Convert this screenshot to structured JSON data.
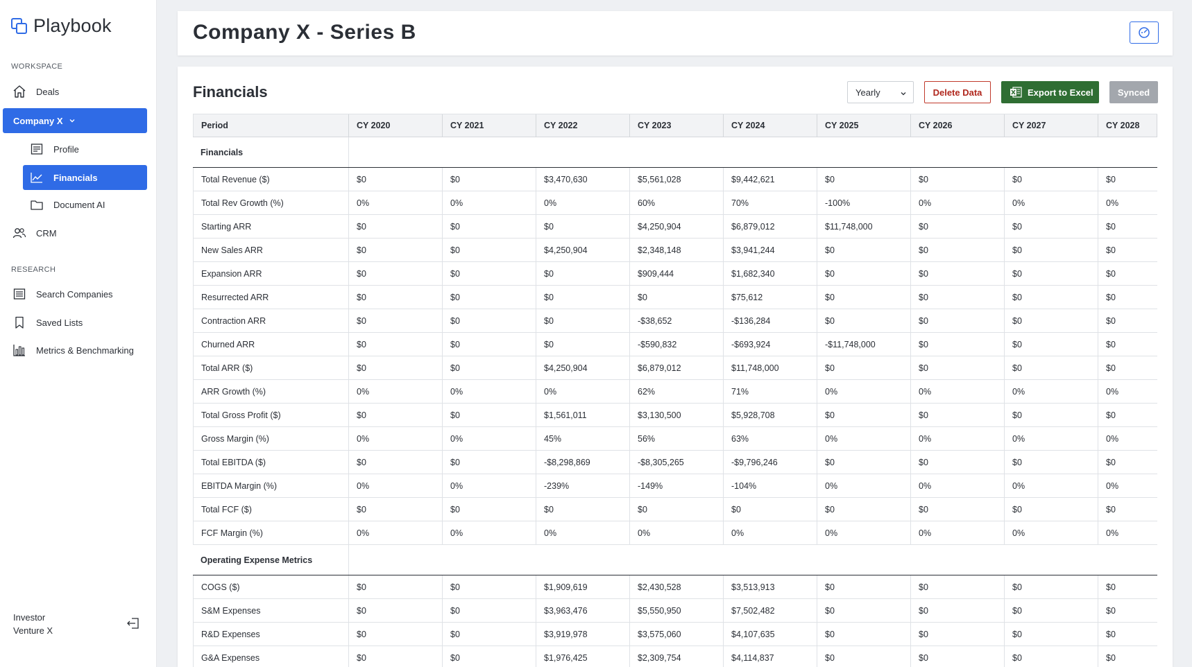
{
  "app": {
    "name": "Playbook",
    "brand_color": "#2f6be6"
  },
  "sidebar": {
    "workspace_label": "WORKSPACE",
    "deals": "Deals",
    "company": "Company X",
    "company_sub": [
      "Profile",
      "Financials",
      "Document AI"
    ],
    "crm": "CRM",
    "research_label": "RESEARCH",
    "research_items": [
      "Search Companies",
      "Saved Lists",
      "Metrics & Benchmarking"
    ],
    "user_role": "Investor",
    "user_org": "Venture X"
  },
  "header": {
    "title": "Company X - Series B"
  },
  "financials": {
    "title": "Financials",
    "period_select": "Yearly",
    "delete_label": "Delete Data",
    "export_label": "Export to Excel",
    "synced_label": "Synced",
    "columns": [
      "Period",
      "CY 2020",
      "CY 2021",
      "CY 2022",
      "CY 2023",
      "CY 2024",
      "CY 2025",
      "CY 2026",
      "CY 2027",
      "CY 2028"
    ],
    "groups": [
      {
        "name": "Financials",
        "rows": [
          {
            "label": "Total Revenue ($)",
            "values": [
              "$0",
              "$0",
              "$3,470,630",
              "$5,561,028",
              "$9,442,621",
              "$0",
              "$0",
              "$0",
              "$0"
            ]
          },
          {
            "label": "Total Rev Growth (%)",
            "values": [
              "0%",
              "0%",
              "0%",
              "60%",
              "70%",
              "-100%",
              "0%",
              "0%",
              "0%"
            ]
          },
          {
            "label": "Starting ARR",
            "values": [
              "$0",
              "$0",
              "$0",
              "$4,250,904",
              "$6,879,012",
              "$11,748,000",
              "$0",
              "$0",
              "$0"
            ]
          },
          {
            "label": "New Sales ARR",
            "values": [
              "$0",
              "$0",
              "$4,250,904",
              "$2,348,148",
              "$3,941,244",
              "$0",
              "$0",
              "$0",
              "$0"
            ]
          },
          {
            "label": "Expansion ARR",
            "values": [
              "$0",
              "$0",
              "$0",
              "$909,444",
              "$1,682,340",
              "$0",
              "$0",
              "$0",
              "$0"
            ]
          },
          {
            "label": "Resurrected ARR",
            "values": [
              "$0",
              "$0",
              "$0",
              "$0",
              "$75,612",
              "$0",
              "$0",
              "$0",
              "$0"
            ]
          },
          {
            "label": "Contraction ARR",
            "values": [
              "$0",
              "$0",
              "$0",
              "-$38,652",
              "-$136,284",
              "$0",
              "$0",
              "$0",
              "$0"
            ]
          },
          {
            "label": "Churned ARR",
            "values": [
              "$0",
              "$0",
              "$0",
              "-$590,832",
              "-$693,924",
              "-$11,748,000",
              "$0",
              "$0",
              "$0"
            ]
          },
          {
            "label": "Total ARR ($)",
            "values": [
              "$0",
              "$0",
              "$4,250,904",
              "$6,879,012",
              "$11,748,000",
              "$0",
              "$0",
              "$0",
              "$0"
            ]
          },
          {
            "label": "ARR Growth (%)",
            "values": [
              "0%",
              "0%",
              "0%",
              "62%",
              "71%",
              "0%",
              "0%",
              "0%",
              "0%"
            ]
          },
          {
            "label": "Total Gross Profit ($)",
            "values": [
              "$0",
              "$0",
              "$1,561,011",
              "$3,130,500",
              "$5,928,708",
              "$0",
              "$0",
              "$0",
              "$0"
            ]
          },
          {
            "label": "Gross Margin (%)",
            "values": [
              "0%",
              "0%",
              "45%",
              "56%",
              "63%",
              "0%",
              "0%",
              "0%",
              "0%"
            ]
          },
          {
            "label": "Total EBITDA ($)",
            "values": [
              "$0",
              "$0",
              "-$8,298,869",
              "-$8,305,265",
              "-$9,796,246",
              "$0",
              "$0",
              "$0",
              "$0"
            ]
          },
          {
            "label": "EBITDA Margin (%)",
            "values": [
              "0%",
              "0%",
              "-239%",
              "-149%",
              "-104%",
              "0%",
              "0%",
              "0%",
              "0%"
            ]
          },
          {
            "label": "Total FCF ($)",
            "values": [
              "$0",
              "$0",
              "$0",
              "$0",
              "$0",
              "$0",
              "$0",
              "$0",
              "$0"
            ]
          },
          {
            "label": "FCF Margin (%)",
            "values": [
              "0%",
              "0%",
              "0%",
              "0%",
              "0%",
              "0%",
              "0%",
              "0%",
              "0%"
            ]
          }
        ]
      },
      {
        "name": "Operating Expense Metrics",
        "rows": [
          {
            "label": "COGS ($)",
            "values": [
              "$0",
              "$0",
              "$1,909,619",
              "$2,430,528",
              "$3,513,913",
              "$0",
              "$0",
              "$0",
              "$0"
            ]
          },
          {
            "label": "S&M Expenses",
            "values": [
              "$0",
              "$0",
              "$3,963,476",
              "$5,550,950",
              "$7,502,482",
              "$0",
              "$0",
              "$0",
              "$0"
            ]
          },
          {
            "label": "R&D Expenses",
            "values": [
              "$0",
              "$0",
              "$3,919,978",
              "$3,575,060",
              "$4,107,635",
              "$0",
              "$0",
              "$0",
              "$0"
            ]
          },
          {
            "label": "G&A Expenses",
            "values": [
              "$0",
              "$0",
              "$1,976,425",
              "$2,309,754",
              "$4,114,837",
              "$0",
              "$0",
              "$0",
              "$0"
            ]
          }
        ]
      }
    ]
  }
}
